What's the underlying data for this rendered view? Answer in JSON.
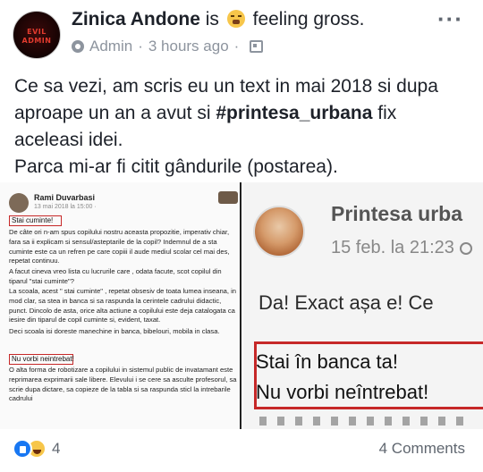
{
  "post": {
    "author": "Zinica Andone",
    "feeling_prefix": "is",
    "feeling_icon": "disgusted-face-icon",
    "feeling_text": "feeling gross.",
    "avatar_text_line1": "EVIL",
    "avatar_text_line2": "ADMIN",
    "role": "Admin",
    "separator": "·",
    "time": "3 hours ago",
    "time_suffix": "·",
    "text_line1": "Ce sa vezi,  am scris eu un text in mai 2018 si dupa",
    "text_line2a": "aproape un an a avut si ",
    "hashtag": "#printesa_urbana",
    "text_line2b": " fix",
    "text_line3": "aceleasi idei.",
    "text_line4": "Parca mi-ar fi citit gândurile (postarea)."
  },
  "left_screenshot": {
    "name": "Rami Duvarbasi",
    "date": "13 mai 2018 la 15:00 · ",
    "box1": "Stai cuminte!",
    "para1": "De câte ori n-am spus copilului nostru aceasta propozitie, imperativ chiar, fara sa ii explicam si sensul/asteptarile de la copil? Indemnul de a sta cuminte este ca un refren pe care copiii il aude mediul scolar cel mai des, repetat continuu.",
    "para2": "A facut cineva vreo lista cu lucrurile care , odata facute, scot copilul din tiparul \"stai cuminte\"?",
    "para3": "La scoala, acest \" stai cuminte\" , repetat obsesiv de toata lumea inseana, in mod clar, sa stea in banca si sa raspunda la cerintele cadrului didactic, punct. Dincolo de asta, orice alta actiune a copilului este deja catalogata ca iesire din tiparul de copil cuminte si, evident, taxat.",
    "para4": "Deci scoala isi doreste manechine in banca, bibelouri, mobila in clasa.",
    "box2": "Nu vorbi neintrebat!",
    "para5": "O alta forma de robotizare a copilului in sistemul public de invatamant este reprimarea exprimarii sale libere. Elevului i se cere sa asculte profesorul, sa scrie dupa dictare, sa copieze de la tabla si sa raspunda sticl la intrebarile cadrului"
  },
  "right_screenshot": {
    "name": "Printesa urba",
    "date": "15 feb. la 21:23",
    "line1": "Da! Exact așa e! Ce",
    "box_line1": "Stai în banca ta!",
    "box_line2": "Nu vorbi neîntrebat!"
  },
  "footer": {
    "reaction_icons": [
      "like-icon",
      "haha-icon"
    ],
    "reaction_count": "4",
    "comments": "4 Comments"
  },
  "colors": {
    "text": "#1d2129",
    "meta": "#8d949e",
    "highlight_box": "#c62828",
    "like_blue": "#1877f2"
  }
}
